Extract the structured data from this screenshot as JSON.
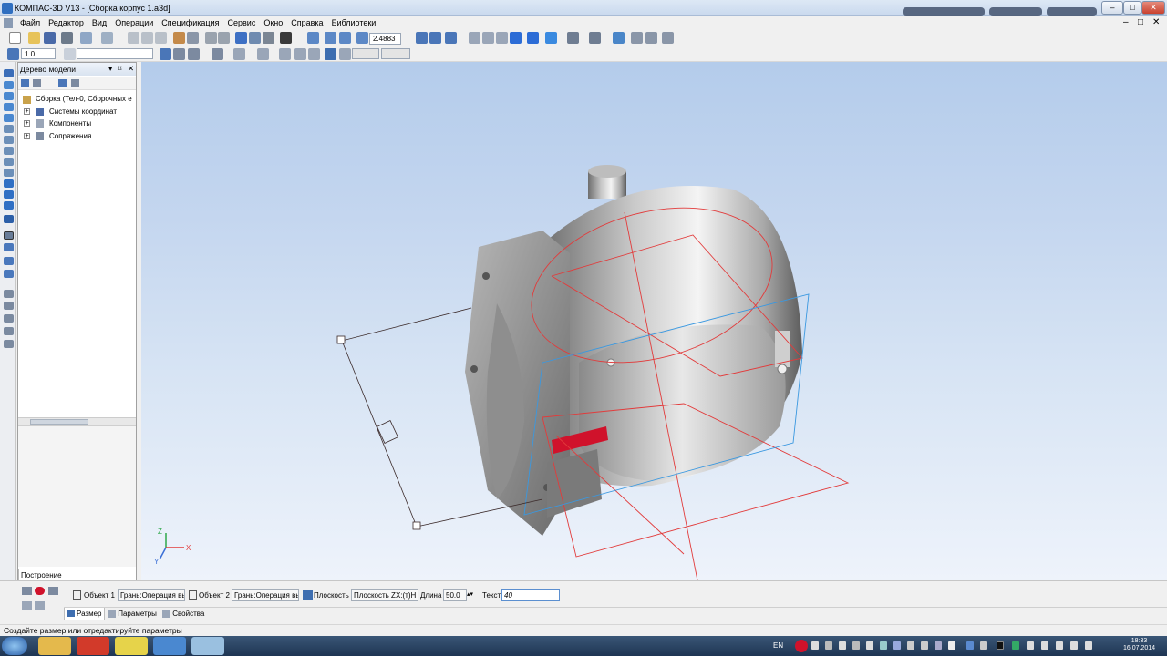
{
  "window": {
    "title": "КОМПАС-3D V13 - [Сборка корпус 1.a3d]",
    "controls": [
      "–",
      "□",
      "✕"
    ],
    "mdi_controls": [
      "–",
      "□",
      "✕"
    ]
  },
  "menu": [
    "Файл",
    "Редактор",
    "Вид",
    "Операции",
    "Спецификация",
    "Сервис",
    "Окно",
    "Справка",
    "Библиотеки"
  ],
  "toolbar": {
    "zoom_value": "2.4883",
    "step_value": "1.0"
  },
  "model_tree": {
    "title": "Дерево модели",
    "root": "Сборка (Тел-0, Сборочных е",
    "items": [
      "Системы координат",
      "Компоненты",
      "Сопряжения"
    ],
    "bottom_tab": "Построение"
  },
  "axes": {
    "x": "X",
    "y": "Y",
    "z": "Z"
  },
  "properties": {
    "object1_label": "Объект 1",
    "object1_value": "Грань:Операция вы",
    "object2_label": "Объект 2",
    "object2_value": "Грань:Операция вы",
    "plane_label": "Плоскость",
    "plane_value": "Плоскость ZX:(т)Н",
    "length_label": "Длина",
    "length_value": "50.0",
    "text_label": "Текст",
    "text_value": "40",
    "tabs": [
      "Размер",
      "Параметры",
      "Свойства"
    ]
  },
  "status_text": "Создайте размер или отредактируйте параметры",
  "taskbar": {
    "lang": "EN",
    "time": "18:33",
    "date": "16.07.2014"
  },
  "colors": {
    "viewport_top": "#b4cceb",
    "viewport_bottom": "#eef3fb",
    "part_highlight": "#d0122b",
    "sketch_red": "#e23b3b",
    "sketch_blue": "#3a98e0"
  }
}
